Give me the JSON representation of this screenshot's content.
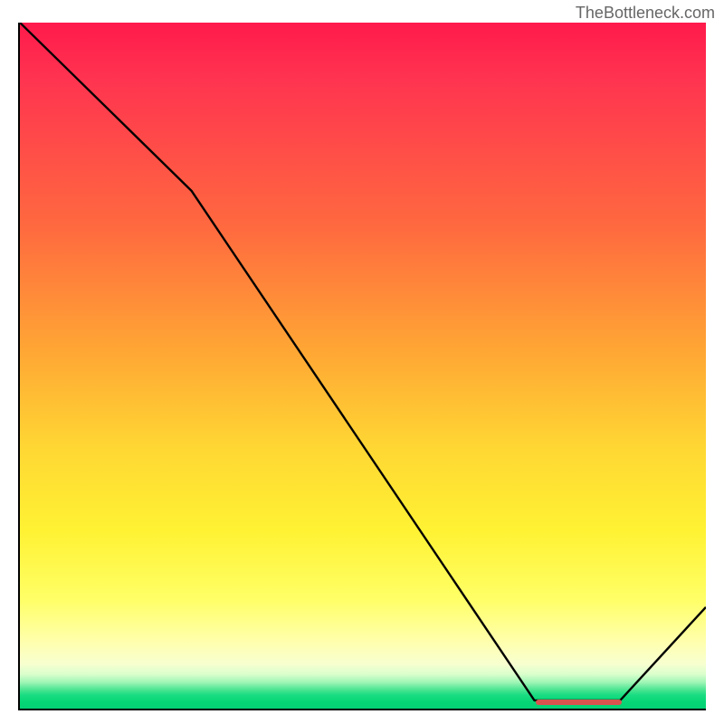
{
  "attribution": "TheBottleneck.com",
  "chart_data": {
    "type": "line",
    "title": "",
    "xlabel": "",
    "ylabel": "",
    "xlim": [
      0,
      100
    ],
    "ylim": [
      0,
      100
    ],
    "x": [
      0,
      25,
      75,
      87.5,
      100
    ],
    "values": [
      100,
      75.5,
      1.2,
      1.2,
      14.8
    ],
    "optimal_band": {
      "x_start": 75,
      "x_end": 87.5,
      "y": 1.2
    },
    "background_gradient": {
      "direction": "vertical",
      "stops": [
        {
          "pos": 0.0,
          "meaning": "worst",
          "color": "#ff1a4b"
        },
        {
          "pos": 0.5,
          "meaning": "mid",
          "color": "#ffb533"
        },
        {
          "pos": 0.8,
          "meaning": "good",
          "color": "#ffff66"
        },
        {
          "pos": 1.0,
          "meaning": "best",
          "color": "#04d074"
        }
      ]
    }
  }
}
